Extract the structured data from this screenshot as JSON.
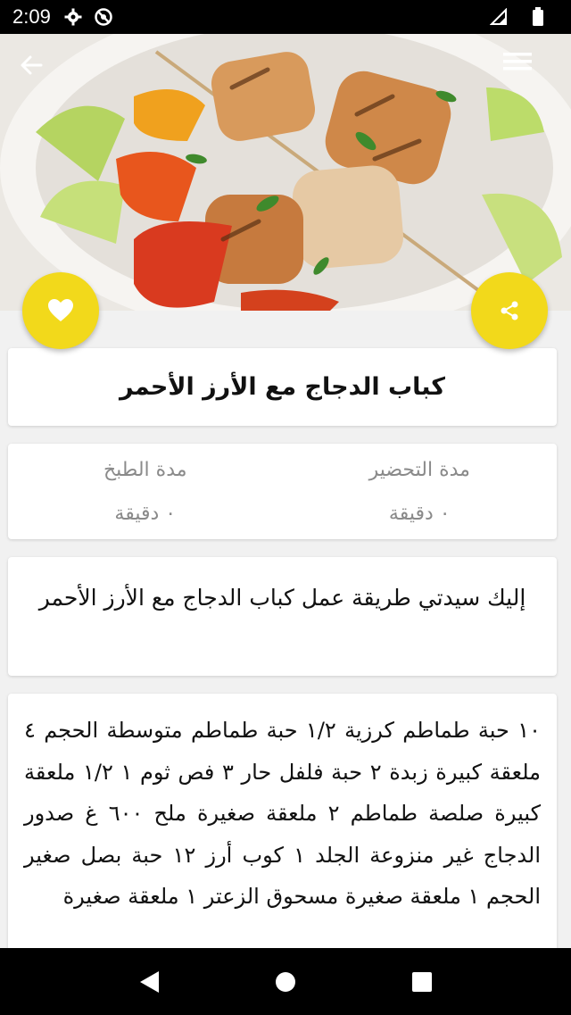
{
  "status_bar": {
    "time": "2:09",
    "icons": [
      "settings-icon",
      "no-disturb-icon",
      "signal-icon",
      "battery-icon"
    ]
  },
  "header": {
    "back_icon": "arrow-back-icon",
    "menu_icon": "hamburger-menu-icon"
  },
  "actions": {
    "favorite_icon": "heart-icon",
    "share_icon": "share-icon",
    "accent": "#f2d91b"
  },
  "recipe": {
    "title": "كباب الدجاج مع الأرز الأحمر",
    "prep_label": "مدة التحضير",
    "prep_value": "٠ دقيقة",
    "cook_label": "مدة الطبخ",
    "cook_value": "٠ دقيقة",
    "intro": "إليك سيدتي طريقة عمل كباب الدجاج مع الأرز الأحمر",
    "ingredients": "١٠ حبة طماطم كرزية ١/٢ حبة طماطم متوسطة الحجم ٤ ملعقة كبيرة زبدة ٢ حبة فلفل حار ٣ فص ثوم ١ ١/٢ ملعقة كبيرة صلصة طماطم ٢ ملعقة صغيرة ملح ٦٠٠ غ صدور الدجاج غير منزوعة الجلد ١ كوب أرز ١٢ حبة بصل صغير الحجم ١ ملعقة صغيرة مسحوق الزعتر ١ ملعقة صغيرة"
  },
  "nav_bar": {
    "back_icon": "nav-back-icon",
    "home_icon": "nav-home-icon",
    "recents_icon": "nav-recents-icon"
  }
}
